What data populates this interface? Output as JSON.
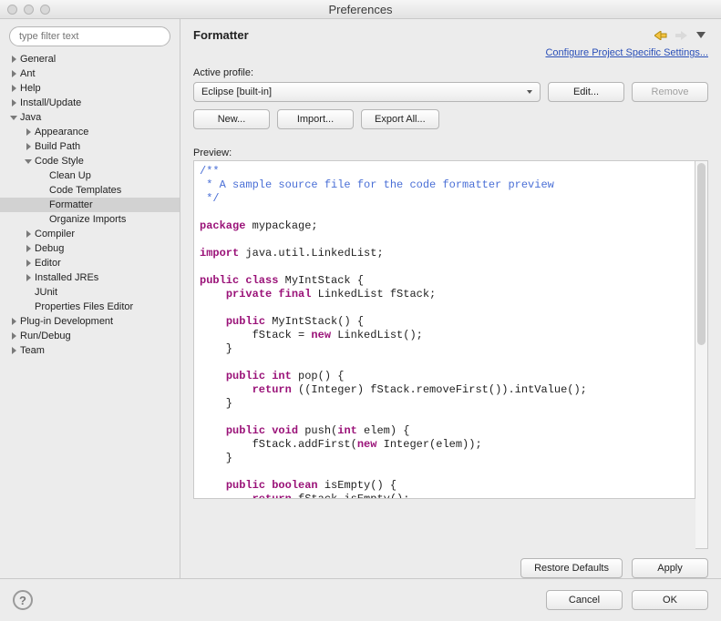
{
  "window": {
    "title": "Preferences"
  },
  "filter": {
    "placeholder": "type filter text"
  },
  "tree": [
    {
      "label": "General",
      "depth": 0,
      "arrow": "right"
    },
    {
      "label": "Ant",
      "depth": 0,
      "arrow": "right"
    },
    {
      "label": "Help",
      "depth": 0,
      "arrow": "right"
    },
    {
      "label": "Install/Update",
      "depth": 0,
      "arrow": "right"
    },
    {
      "label": "Java",
      "depth": 0,
      "arrow": "down"
    },
    {
      "label": "Appearance",
      "depth": 1,
      "arrow": "right"
    },
    {
      "label": "Build Path",
      "depth": 1,
      "arrow": "right"
    },
    {
      "label": "Code Style",
      "depth": 1,
      "arrow": "down"
    },
    {
      "label": "Clean Up",
      "depth": 2,
      "arrow": "none"
    },
    {
      "label": "Code Templates",
      "depth": 2,
      "arrow": "none"
    },
    {
      "label": "Formatter",
      "depth": 2,
      "arrow": "none",
      "selected": true
    },
    {
      "label": "Organize Imports",
      "depth": 2,
      "arrow": "none"
    },
    {
      "label": "Compiler",
      "depth": 1,
      "arrow": "right"
    },
    {
      "label": "Debug",
      "depth": 1,
      "arrow": "right"
    },
    {
      "label": "Editor",
      "depth": 1,
      "arrow": "right"
    },
    {
      "label": "Installed JREs",
      "depth": 1,
      "arrow": "right"
    },
    {
      "label": "JUnit",
      "depth": 1,
      "arrow": "none"
    },
    {
      "label": "Properties Files Editor",
      "depth": 1,
      "arrow": "none"
    },
    {
      "label": "Plug-in Development",
      "depth": 0,
      "arrow": "right"
    },
    {
      "label": "Run/Debug",
      "depth": 0,
      "arrow": "right"
    },
    {
      "label": "Team",
      "depth": 0,
      "arrow": "right"
    }
  ],
  "header": {
    "title": "Formatter"
  },
  "link": {
    "text": "Configure Project Specific Settings..."
  },
  "profile": {
    "label": "Active profile:",
    "value": "Eclipse [built-in]"
  },
  "buttons": {
    "edit": "Edit...",
    "remove": "Remove",
    "new": "New...",
    "import": "Import...",
    "export": "Export All...",
    "restore": "Restore Defaults",
    "apply": "Apply",
    "cancel": "Cancel",
    "ok": "OK"
  },
  "preview": {
    "label": "Preview:",
    "lines": [
      {
        "t": "/**",
        "cls": "c-doc"
      },
      {
        "t": " * A sample source file for the code formatter preview",
        "cls": "c-doc"
      },
      {
        "t": " */",
        "cls": "c-doc"
      },
      {
        "t": "",
        "cls": ""
      },
      {
        "segments": [
          {
            "t": "package",
            "cls": "c-kw"
          },
          {
            "t": " mypackage;",
            "cls": ""
          }
        ]
      },
      {
        "t": "",
        "cls": ""
      },
      {
        "segments": [
          {
            "t": "import",
            "cls": "c-kw"
          },
          {
            "t": " java.util.LinkedList;",
            "cls": ""
          }
        ]
      },
      {
        "t": "",
        "cls": ""
      },
      {
        "segments": [
          {
            "t": "public class",
            "cls": "c-kw"
          },
          {
            "t": " MyIntStack {",
            "cls": ""
          }
        ]
      },
      {
        "segments": [
          {
            "t": "    ",
            "cls": ""
          },
          {
            "t": "private final",
            "cls": "c-kw"
          },
          {
            "t": " LinkedList fStack;",
            "cls": ""
          }
        ]
      },
      {
        "t": "",
        "cls": ""
      },
      {
        "segments": [
          {
            "t": "    ",
            "cls": ""
          },
          {
            "t": "public",
            "cls": "c-kw"
          },
          {
            "t": " MyIntStack() {",
            "cls": ""
          }
        ]
      },
      {
        "segments": [
          {
            "t": "        fStack = ",
            "cls": ""
          },
          {
            "t": "new",
            "cls": "c-kw"
          },
          {
            "t": " LinkedList();",
            "cls": ""
          }
        ]
      },
      {
        "t": "    }",
        "cls": ""
      },
      {
        "t": "",
        "cls": ""
      },
      {
        "segments": [
          {
            "t": "    ",
            "cls": ""
          },
          {
            "t": "public int",
            "cls": "c-kw"
          },
          {
            "t": " pop() {",
            "cls": ""
          }
        ]
      },
      {
        "segments": [
          {
            "t": "        ",
            "cls": ""
          },
          {
            "t": "return",
            "cls": "c-kw"
          },
          {
            "t": " ((Integer) fStack.removeFirst()).intValue();",
            "cls": ""
          }
        ]
      },
      {
        "t": "    }",
        "cls": ""
      },
      {
        "t": "",
        "cls": ""
      },
      {
        "segments": [
          {
            "t": "    ",
            "cls": ""
          },
          {
            "t": "public void",
            "cls": "c-kw"
          },
          {
            "t": " push(",
            "cls": ""
          },
          {
            "t": "int",
            "cls": "c-kw"
          },
          {
            "t": " elem) {",
            "cls": ""
          }
        ]
      },
      {
        "segments": [
          {
            "t": "        fStack.addFirst(",
            "cls": ""
          },
          {
            "t": "new",
            "cls": "c-kw"
          },
          {
            "t": " Integer(elem));",
            "cls": ""
          }
        ]
      },
      {
        "t": "    }",
        "cls": ""
      },
      {
        "t": "",
        "cls": ""
      },
      {
        "segments": [
          {
            "t": "    ",
            "cls": ""
          },
          {
            "t": "public boolean",
            "cls": "c-kw"
          },
          {
            "t": " isEmpty() {",
            "cls": ""
          }
        ]
      },
      {
        "segments": [
          {
            "t": "        ",
            "cls": ""
          },
          {
            "t": "return",
            "cls": "c-kw"
          },
          {
            "t": " fStack.isEmpty();",
            "cls": ""
          }
        ]
      }
    ]
  },
  "help": "?"
}
